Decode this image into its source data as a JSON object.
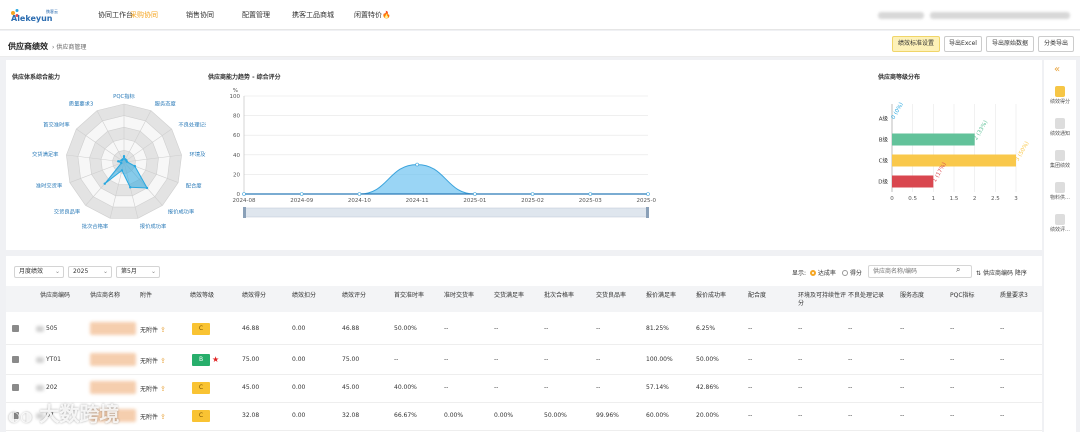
{
  "brand": {
    "logo_text": "Alekeyun",
    "logo_sub": "携客云"
  },
  "nav": {
    "items": [
      "协同工作台",
      "采购协同",
      "销售协同",
      "配置管理",
      "携客工品商城",
      "闲置特价"
    ],
    "active_index": 1,
    "fire_icon": "🔥"
  },
  "page": {
    "title": "供应商绩效",
    "breadcrumb_sep": "›",
    "breadcrumb": "供应商管理",
    "buttons": [
      "绩效标准设置",
      "导出Excel",
      "导出原始数据",
      "分类导出"
    ]
  },
  "radar": {
    "title": "供应体系综合能力",
    "axes": [
      "PQC指标",
      "服务态度",
      "不良处理记录",
      "环境及可持续性评分",
      "配合度",
      "报价成功率",
      "报价成功率",
      "批次合格率",
      "交货良品率",
      "准时交货率",
      "交货满足率",
      "首交准时率",
      "质量要求3"
    ],
    "values": [
      0.1,
      0.05,
      0.05,
      0.05,
      0.2,
      0.6,
      0.45,
      0.15,
      0.5,
      0.05,
      0.1,
      0.05,
      0.05
    ],
    "accent": "#29a8e0"
  },
  "trend": {
    "title": "供应商能力趋势 - 综合评分",
    "unit": "%",
    "y_ticks": [
      "100",
      "80",
      "60",
      "40",
      "20",
      "0"
    ],
    "x_ticks": [
      "2024-08",
      "2024-09",
      "2024-10",
      "2024-11",
      "2025-01",
      "2025-02",
      "2025-03",
      "2025-05"
    ]
  },
  "chart_data": [
    {
      "type": "area",
      "title": "供应商能力趋势 - 综合评分",
      "ylabel": "%",
      "x": [
        "2024-08",
        "2024-09",
        "2024-10",
        "2024-11",
        "2025-01",
        "2025-02",
        "2025-03",
        "2025-05"
      ],
      "series": [
        {
          "values": [
            0,
            0,
            0,
            30,
            0,
            0,
            0,
            0
          ]
        }
      ],
      "ylim": [
        0,
        100
      ]
    },
    {
      "type": "bar",
      "title": "供应商等级分布",
      "categories": [
        "A级",
        "B级",
        "C级",
        "D级"
      ],
      "values": [
        0,
        2,
        3,
        1
      ],
      "data_labels": [
        "0 (0%)",
        "2 (33%)",
        "3 (50%)",
        "1 (17%)"
      ],
      "xlim": [
        0,
        3
      ],
      "x_ticks": [
        "0",
        "0.5",
        "1",
        "1.5",
        "2",
        "2.5",
        "3"
      ],
      "colors": [
        "#29a8e0",
        "#62c29a",
        "#f9c84b",
        "#d9474f"
      ]
    }
  ],
  "grade": {
    "title": "供应商等级分布",
    "labels": [
      "A级",
      "B级",
      "C级",
      "D级"
    ],
    "data_labels": [
      "0 (0%)",
      "2 (33%)",
      "3 (50%)",
      "1 (17%)"
    ],
    "x_ticks": [
      "0",
      "0.5",
      "1",
      "1.5",
      "2",
      "2.5",
      "3"
    ]
  },
  "rail": {
    "collapse_icon": "«",
    "items": [
      "绩效得分",
      "绩效通知",
      "集团绩效",
      "物料供…",
      "绩效评…"
    ]
  },
  "filters": {
    "period": "月度绩效",
    "year": "2025",
    "month": "第5月",
    "display_label": "显示:",
    "radio_rate": "达成率",
    "radio_score": "得分",
    "search_placeholder": "供应商名称/编码",
    "sort_label": "供应商编码 降序"
  },
  "table": {
    "headers": [
      "供应商编码",
      "供应商名称",
      "附件",
      "绩效等级",
      "绩效得分",
      "绩效扣分",
      "绩效评分",
      "首交准时率",
      "准时交货率",
      "交货满足率",
      "批次合格率",
      "交货良品率",
      "报价满足率",
      "报价成功率",
      "配合度",
      "环境及可持续性评分",
      "不良处理记录",
      "服务态度",
      "PQC指标",
      "质量要求3"
    ],
    "rows": [
      {
        "code": "505",
        "attach": "无附件",
        "grade": "C",
        "star": "",
        "score": "46.88",
        "deduct": "0.00",
        "rating": "46.88",
        "c1": "50.00%",
        "c2": "--",
        "c3": "--",
        "c4": "--",
        "c5": "--",
        "c6": "81.25%",
        "c7": "6.25%",
        "c8": "--",
        "c9": "--",
        "c10": "--",
        "c11": "--",
        "c12": "--",
        "c13": "--"
      },
      {
        "code": "YT01",
        "attach": "无附件",
        "grade": "B",
        "star": "★",
        "score": "75.00",
        "deduct": "0.00",
        "rating": "75.00",
        "c1": "--",
        "c2": "--",
        "c3": "--",
        "c4": "--",
        "c5": "--",
        "c6": "100.00%",
        "c7": "50.00%",
        "c8": "--",
        "c9": "--",
        "c10": "--",
        "c11": "--",
        "c12": "--",
        "c13": "--"
      },
      {
        "code": "202",
        "attach": "无附件",
        "grade": "C",
        "star": "",
        "score": "45.00",
        "deduct": "0.00",
        "rating": "45.00",
        "c1": "40.00%",
        "c2": "--",
        "c3": "--",
        "c4": "--",
        "c5": "--",
        "c6": "57.14%",
        "c7": "42.86%",
        "c8": "--",
        "c9": "--",
        "c10": "--",
        "c11": "--",
        "c12": "--",
        "c13": "--"
      },
      {
        "code": "07",
        "attach": "无附件",
        "grade": "C",
        "star": "",
        "score": "32.08",
        "deduct": "0.00",
        "rating": "32.08",
        "c1": "66.67%",
        "c2": "0.00%",
        "c3": "0.00%",
        "c4": "50.00%",
        "c5": "99.96%",
        "c6": "60.00%",
        "c7": "20.00%",
        "c8": "--",
        "c9": "--",
        "c10": "--",
        "c11": "--",
        "c12": "--",
        "c13": "--"
      }
    ]
  },
  "watermark": "大数跨境"
}
